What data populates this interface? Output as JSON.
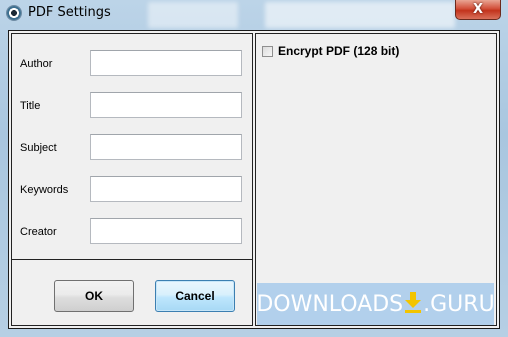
{
  "window": {
    "title": "PDF Settings",
    "close_glyph": "X",
    "app_icon": "pdf-settings-icon"
  },
  "form": {
    "fields": [
      {
        "label": "Author",
        "value": ""
      },
      {
        "label": "Title",
        "value": ""
      },
      {
        "label": "Subject",
        "value": ""
      },
      {
        "label": "Keywords",
        "value": ""
      },
      {
        "label": "Creator",
        "value": ""
      }
    ]
  },
  "buttons": {
    "ok": "OK",
    "cancel": "Cancel"
  },
  "options": {
    "encrypt_label": "Encrypt PDF (128 bit)",
    "encrypt_checked": false
  },
  "watermark": {
    "text_left": "DOWNLOADS",
    "text_right": ".GURU",
    "icon": "download-arrow-icon"
  },
  "colors": {
    "close_button": "#c2331c",
    "default_button_border": "#3c7fb1",
    "watermark_arrow": "#f2c400"
  }
}
